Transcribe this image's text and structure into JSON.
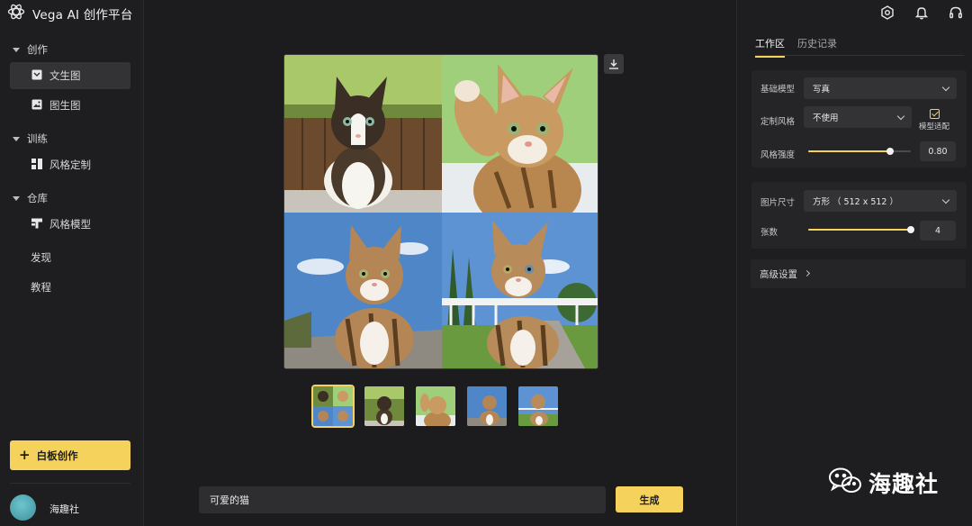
{
  "app": {
    "title": "Vega AI 创作平台"
  },
  "sidebar": {
    "groups": [
      {
        "label": "创作",
        "items": [
          {
            "label": "文生图",
            "icon": "image-text-icon",
            "active": true
          },
          {
            "label": "图生图",
            "icon": "image-icon",
            "active": false
          }
        ]
      },
      {
        "label": "训练",
        "items": [
          {
            "label": "风格定制",
            "icon": "layout-icon",
            "active": false
          }
        ]
      },
      {
        "label": "仓库",
        "items": [
          {
            "label": "风格模型",
            "icon": "model-icon",
            "active": false
          }
        ]
      }
    ],
    "plain_items": [
      "发现",
      "教程"
    ],
    "whiteboard_button": "白板创作",
    "user": {
      "name": "海趣社"
    }
  },
  "main": {
    "prompt": {
      "value": "可爱的猫"
    },
    "generate_label": "生成",
    "thumbnails": [
      "grid",
      "cat-sitting-standing",
      "cat-raised-paw",
      "cat-field",
      "cat-fence"
    ],
    "selected_thumbnail": 0
  },
  "right_panel": {
    "tabs": [
      {
        "label": "工作区",
        "active": true
      },
      {
        "label": "历史记录",
        "active": false
      }
    ],
    "base_model": {
      "label": "基础模型",
      "value": "写真"
    },
    "custom_style": {
      "label": "定制风格",
      "value": "不使用"
    },
    "model_adapt": {
      "label": "模型适配",
      "checked": true
    },
    "style_strength": {
      "label": "风格强度",
      "value": "0.80",
      "fraction": 0.8
    },
    "image_size": {
      "label": "图片尺寸",
      "value": "方形 （ 512 x 512 ）"
    },
    "count": {
      "label": "张数",
      "value": "4",
      "fraction": 1.0
    },
    "advanced": {
      "label": "高级设置"
    }
  },
  "watermark": {
    "text": "海趣社"
  },
  "colors": {
    "accent": "#f5d25c",
    "background": "#1c1c1e",
    "panel": "#252528"
  }
}
